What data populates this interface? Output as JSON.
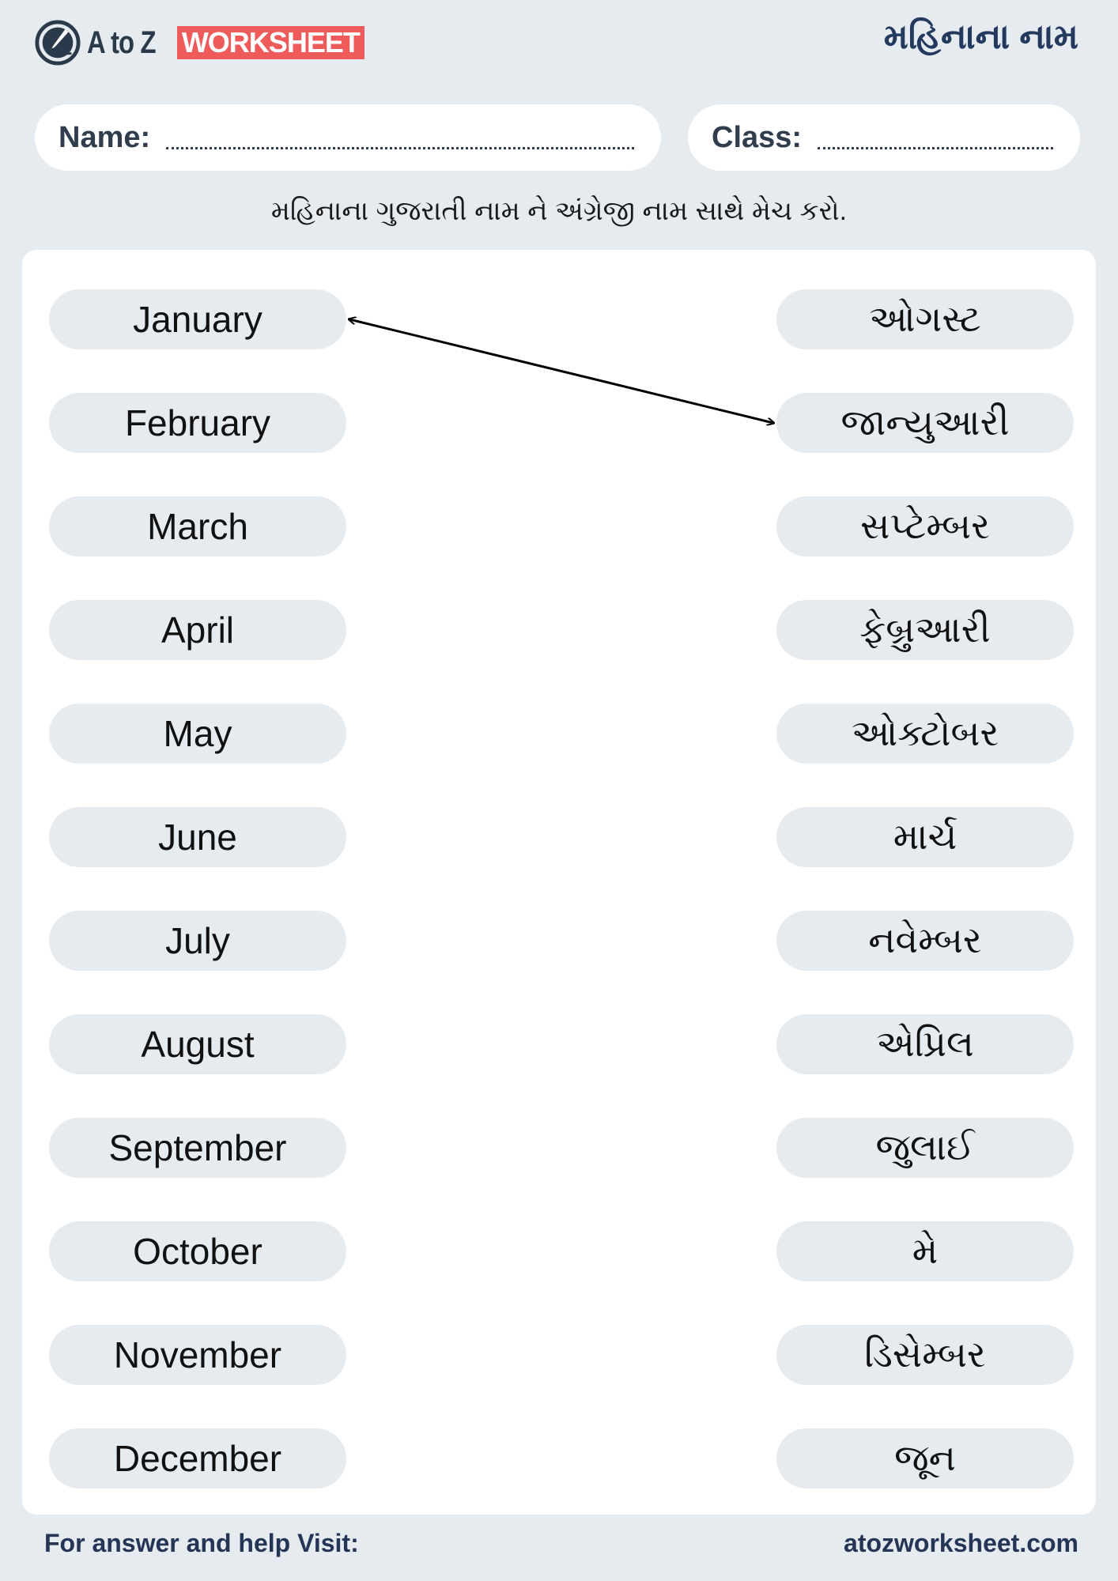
{
  "header": {
    "logo_text": "A to Z",
    "logo_badge": "WORKSHEET",
    "title": "મહિનાના નામ",
    "brand_color": "#ef5b5b",
    "title_color": "#233a5e"
  },
  "form": {
    "name_label": "Name:",
    "class_label": "Class:"
  },
  "instruction": "મહિનાના ગુજરાતી નામ ને અંગ્રેજી નામ સાથે મેચ કરો.",
  "english_months": [
    "January",
    "February",
    "March",
    "April",
    "May",
    "June",
    "July",
    "August",
    "September",
    "October",
    "November",
    "December"
  ],
  "gujarati_months": [
    "ઓગસ્ટ",
    "જાન્યુઆરી",
    "સપ્ટેમ્બર",
    "ફેબ્રુઆરી",
    "ઓક્ટોબર",
    "માર્ચ",
    "નવેમ્બર",
    "એપ્રિલ",
    "જુલાઈ",
    "મે",
    "ડિસેમ્બર",
    "જૂન"
  ],
  "example_match": {
    "left_index": 0,
    "right_index": 1
  },
  "footer": {
    "left": "For answer and help Visit:",
    "right": "atozworksheet.com"
  }
}
